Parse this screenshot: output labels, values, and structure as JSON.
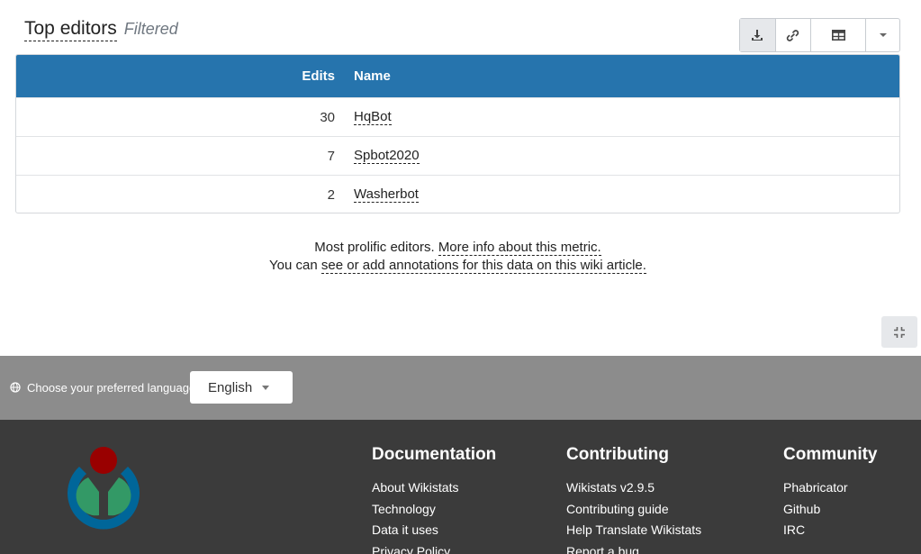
{
  "header": {
    "title": "Top editors",
    "subtitle": "Filtered"
  },
  "toolbar": {
    "download_icon": "download-icon",
    "link_icon": "link-icon",
    "table_icon": "table-icon",
    "caret_icon": "chevron-down-icon"
  },
  "table": {
    "columns": [
      "Edits",
      "Name"
    ],
    "rows": [
      {
        "edits": "30",
        "name": "HqBot"
      },
      {
        "edits": "7",
        "name": "Spbot2020"
      },
      {
        "edits": "2",
        "name": "Washerbot"
      }
    ],
    "header_color": "#2674ad"
  },
  "info": {
    "line1_text": "Most prolific editors.",
    "line1_link": "More info about this metric.",
    "line2_text": "You can",
    "line2_link": "see or add annotations for this data on this wiki article."
  },
  "language": {
    "label": "Choose your preferred language",
    "selected": "English"
  },
  "footer": {
    "documentation": {
      "title": "Documentation",
      "links": [
        "About Wikistats",
        "Technology",
        "Data it uses",
        "Privacy Policy"
      ]
    },
    "contributing": {
      "title": "Contributing",
      "links": [
        "Wikistats v2.9.5",
        "Contributing guide",
        "Help Translate Wikistats",
        "Report a bug"
      ]
    },
    "community": {
      "title": "Community",
      "links": [
        "Phabricator",
        "Github",
        "IRC"
      ]
    }
  }
}
